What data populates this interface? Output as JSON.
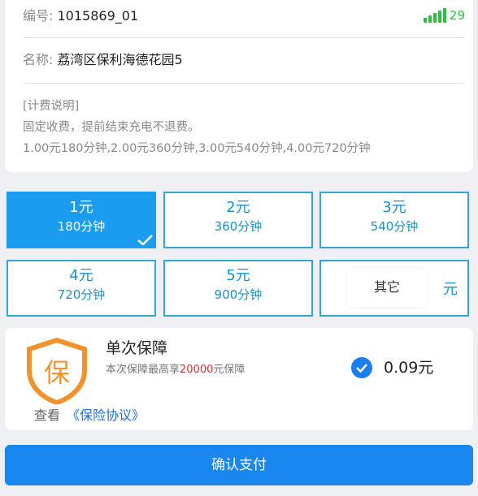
{
  "station": {
    "id_label": "编号:",
    "id_value": "1015869_01",
    "signal_value": "29",
    "name_label": "名称:",
    "name_value": "荔湾区保利海德花园5"
  },
  "fee_info": {
    "heading": "[计费说明]",
    "line1": "固定收费，提前结束充电不退费。",
    "line2": "1.00元180分钟,2.00元360分钟,3.00元540分钟,4.00元720分钟"
  },
  "options": [
    {
      "price": "1元",
      "duration": "180分钟",
      "selected": true
    },
    {
      "price": "2元",
      "duration": "360分钟",
      "selected": false
    },
    {
      "price": "3元",
      "duration": "540分钟",
      "selected": false
    },
    {
      "price": "4元",
      "duration": "720分钟",
      "selected": false
    },
    {
      "price": "5元",
      "duration": "900分钟",
      "selected": false
    }
  ],
  "other_option": {
    "placeholder": "其它",
    "unit": "元"
  },
  "insurance": {
    "icon_char": "保",
    "title": "单次保障",
    "desc_prefix": "本次保障最高享",
    "desc_amount": "20000",
    "desc_suffix": "元保障",
    "checked": true,
    "price": "0.09元",
    "view_label": "查看",
    "agreement_link": "《保险协议》"
  },
  "pay_button": {
    "label": "确认支付"
  },
  "colors": {
    "accent": "#1a86f0",
    "option_border": "#2ea7d8",
    "signal": "#2dbf3a",
    "shield": "#f2922c",
    "highlight": "#d63030"
  }
}
